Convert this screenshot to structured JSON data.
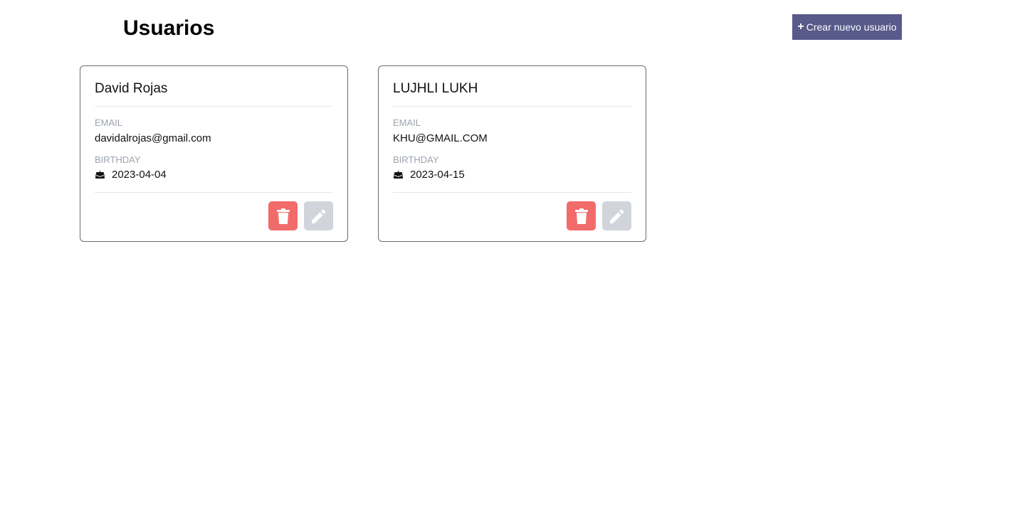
{
  "header": {
    "title": "Usuarios",
    "create_button_label": "Crear nuevo usuario",
    "create_button_icon": "plus-icon"
  },
  "users": [
    {
      "name": "David Rojas",
      "email_label": "EMAIL",
      "email": "davidalrojas@gmail.com",
      "birthday_label": "BIRTHDAY",
      "birthday": "2023-04-04",
      "birthday_icon": "cake-icon"
    },
    {
      "name": "LUJHLI LUKH",
      "email_label": "EMAIL",
      "email": "KHU@GMAIL.COM",
      "birthday_label": "BIRTHDAY",
      "birthday": "2023-04-15",
      "birthday_icon": "cake-icon"
    }
  ],
  "colors": {
    "create_button_bg": "#575a8a",
    "delete_button_bg": "#f26b6b",
    "edit_button_bg": "#d1d5db",
    "label_text": "#9ca3af"
  }
}
